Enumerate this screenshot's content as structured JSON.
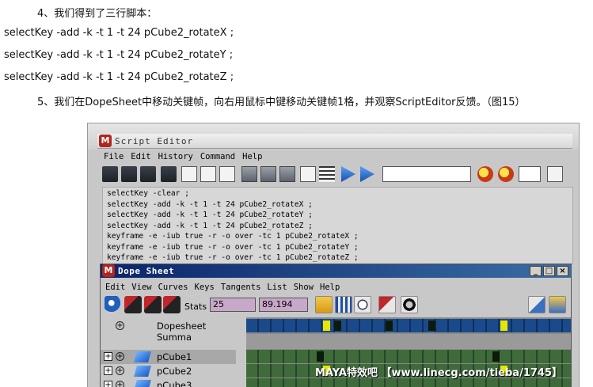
{
  "article": {
    "step4": "4、我们得到了三行脚本：",
    "script_lines": [
      "selectKey -add -k -t 1 -t 24 pCube2_rotateX ;",
      "selectKey -add -k -t 1 -t 24 pCube2_rotateY ;",
      "selectKey -add -k -t 1 -t 24 pCube2_rotateZ ;"
    ],
    "step5": "5、我们在DopeSheet中移动关键帧，向右用鼠标中键移动关键帧1格，并观察ScriptEditor反馈。（图15）"
  },
  "script_editor": {
    "title": "Script Editor",
    "menu": [
      "File",
      "Edit",
      "History",
      "Command",
      "Help"
    ],
    "history": [
      "selectKey -clear ;",
      "selectKey -add -k -t 1 -t 24 pCube2_rotateX ;",
      "selectKey -add -k -t 1 -t 24 pCube2_rotateY ;",
      "selectKey -add -k -t 1 -t 24 pCube2_rotateZ ;",
      "keyframe -e -iub true -r -o over -tc 1 pCube2_rotateX ;",
      "keyframe -e -iub true -r -o over -tc 1 pCube2_rotateY ;",
      "keyframe -e -iub true -r -o over -tc 1 pCube2_rotateZ ;"
    ]
  },
  "dope_sheet": {
    "title": "Dope Sheet",
    "window_buttons": [
      "_",
      "□",
      "×"
    ],
    "menu": [
      "Edit",
      "View",
      "Curves",
      "Keys",
      "Tangents",
      "List",
      "Show",
      "Help"
    ],
    "stats_label": "Stats",
    "stats_value1": "25",
    "stats_value2": "89.194",
    "outliner": [
      "Dopesheet Summa",
      "pCube1",
      "pCube2",
      "pCube3"
    ]
  },
  "watermark": "MAYA特效吧 【www.linecg.com/tieba/1745】",
  "colors": {
    "summary_track": "#1b4a8a",
    "object_track": "#3f6b3a",
    "key_selected": "#e6e600",
    "titlebar_active": "#0a246a"
  }
}
